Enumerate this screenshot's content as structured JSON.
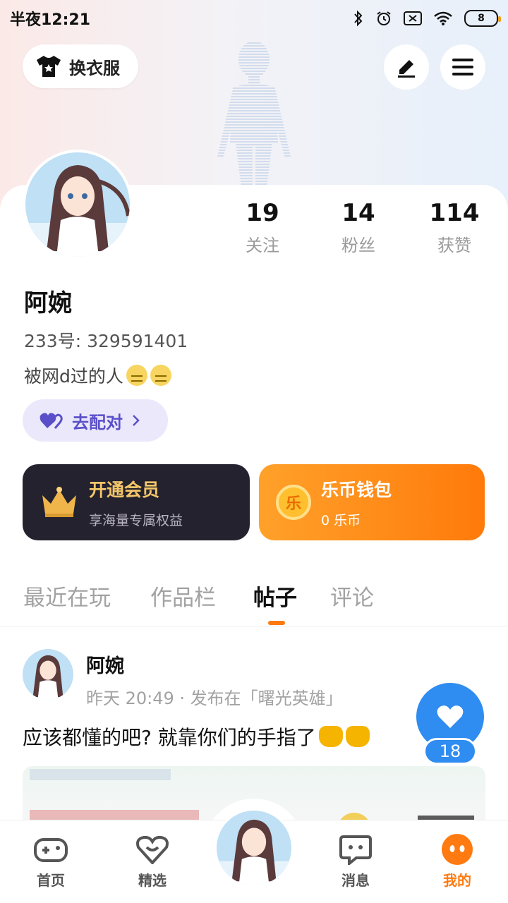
{
  "status_bar": {
    "time": "半夜12:21",
    "battery": "8"
  },
  "header": {
    "outfit_button_label": "换衣服"
  },
  "profile": {
    "name": "阿婉",
    "uid": "233号: 329591401",
    "bio": "被网d过的人",
    "stats": [
      {
        "value": "19",
        "label": "关注"
      },
      {
        "value": "14",
        "label": "粉丝"
      },
      {
        "value": "114",
        "label": "获赞"
      }
    ],
    "match_button_label": "去配对"
  },
  "cards": {
    "vip": {
      "title": "开通会员",
      "subtitle": "享海量专属权益"
    },
    "wallet": {
      "title": "乐币钱包",
      "subtitle": "0 乐币",
      "coin_glyph": "乐"
    }
  },
  "tabs": [
    {
      "label": "最近在玩"
    },
    {
      "label": "作品栏"
    },
    {
      "label": "帖子"
    },
    {
      "label": "评论"
    }
  ],
  "post": {
    "author": "阿婉",
    "meta": "昨天 20:49 · 发布在「曙光英雄」",
    "text": "应该都懂的吧? 就靠你们的手指了",
    "like_count": "18"
  },
  "bottom_nav": [
    {
      "label": "首页",
      "icon": "gamepad-icon"
    },
    {
      "label": "精选",
      "icon": "heart-chat-icon"
    },
    {
      "label": "消息",
      "icon": "message-icon"
    },
    {
      "label": "我的",
      "icon": "face-icon"
    }
  ],
  "colors": {
    "accent": "#ff7a10",
    "like_blue": "#2f8cf0",
    "match_purple": "#5a4fc8",
    "vip_bg": "#24222e"
  }
}
